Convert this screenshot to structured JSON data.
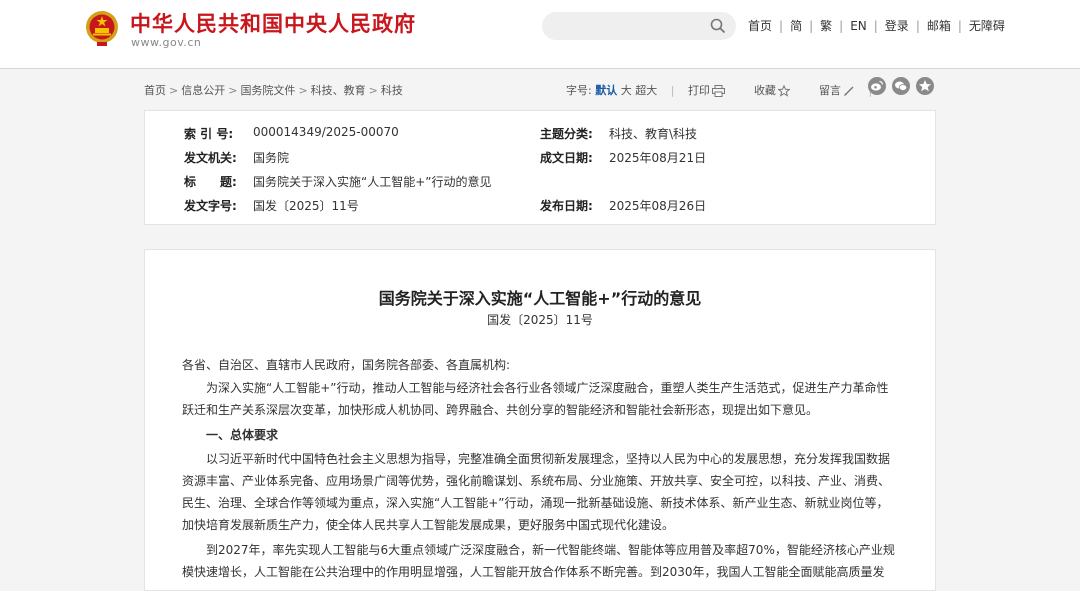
{
  "site": {
    "title": "中华人民共和国中央人民政府",
    "url": "www.gov.cn",
    "colors": {
      "brand_red": "#c8161d",
      "link_blue": "#1a5aa6"
    }
  },
  "search": {
    "placeholder": "",
    "icon": "search-icon"
  },
  "top_links": [
    "首页",
    "简",
    "繁",
    "EN",
    "登录",
    "邮箱",
    "无障碍"
  ],
  "breadcrumb": [
    "首页",
    "信息公开",
    "国务院文件",
    "科技、教育",
    "科技"
  ],
  "tools": {
    "font_size_label": "字号:",
    "font_default": "默认",
    "font_large": "大",
    "font_xlarge": "超大",
    "print": "打印",
    "favorite": "收藏",
    "comment": "留言"
  },
  "share_icons": [
    "weibo-icon",
    "wechat-icon",
    "star-icon"
  ],
  "meta": {
    "index_label": "索 引 号:",
    "index_value": "000014349/2025-00070",
    "category_label": "主题分类:",
    "category_value": "科技、教育\\科技",
    "issuer_label": "发文机关:",
    "issuer_value": "国务院",
    "date_written_label": "成文日期:",
    "date_written_value": "2025年08月21日",
    "title_label": "标　　题:",
    "title_value": "国务院关于深入实施“人工智能+”行动的意见",
    "docno_label": "发文字号:",
    "docno_value": "国发〔2025〕11号",
    "date_published_label": "发布日期:",
    "date_published_value": "2025年08月26日"
  },
  "article": {
    "title": "国务院关于深入实施“人工智能+”行动的意见",
    "doc_no": "国发〔2025〕11号",
    "salutation": "各省、自治区、直辖市人民政府，国务院各部委、各直属机构:",
    "p1": [
      "为深入实施“人工智能+”行动，推动人工智能与经济社会各行业各领域广泛深度融合，重塑人类生产生活范式，促进生产力革命性",
      "跃迁和生产关系深层次变革，加快形成人机协同、跨界融合、共创分享的智能经济和智能社会新形态，现提出如下意见。"
    ],
    "section1": "一、总体要求",
    "p2": [
      "以习近平新时代中国特色社会主义思想为指导，完整准确全面贯彻新发展理念，坚持以人民为中心的发展思想，充分发挥我国数据",
      "资源丰富、产业体系完备、应用场景广阔等优势，强化前瞻谋划、系统布局、分业施策、开放共享、安全可控，以科技、产业、消费、",
      "民生、治理、全球合作等领域为重点，深入实施“人工智能+”行动，涌现一批新基础设施、新技术体系、新产业生态、新就业岗位等，",
      "加快培育发展新质生产力，使全体人民共享人工智能发展成果，更好服务中国式现代化建设。"
    ],
    "p3": [
      "到2027年，率先实现人工智能与6大重点领域广泛深度融合，新一代智能终端、智能体等应用普及率超70%，智能经济核心产业规",
      "模快速增长，人工智能在公共治理中的作用明显增强，人工智能开放合作体系不断完善。到2030年，我国人工智能全面赋能高质量发"
    ]
  }
}
